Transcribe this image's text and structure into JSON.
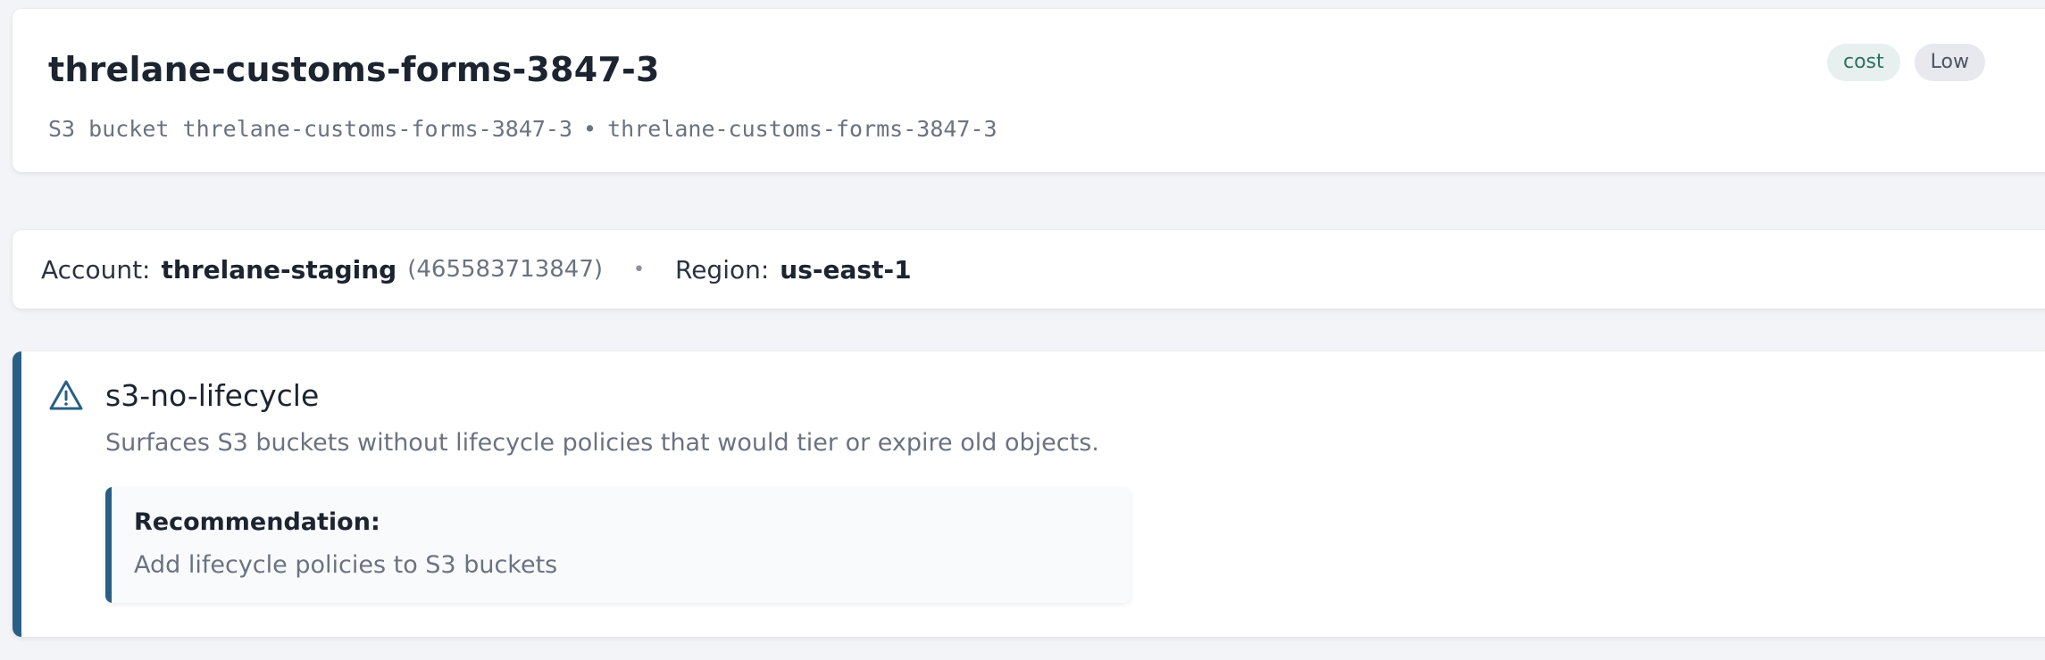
{
  "header": {
    "title": "threlane-customs-forms-3847-3",
    "subtitle_type": "S3 bucket",
    "subtitle_name": "threlane-customs-forms-3847-3",
    "subtitle_separator": "•",
    "subtitle_id": "threlane-customs-forms-3847-3",
    "badges": {
      "category": "cost",
      "severity": "Low"
    }
  },
  "info": {
    "account_label": "Account:",
    "account_name": "threlane-staging",
    "account_id": "(465583713847)",
    "separator": "•",
    "region_label": "Region:",
    "region_value": "us-east-1"
  },
  "finding": {
    "icon": "warning-triangle-icon",
    "title": "s3-no-lifecycle",
    "description": "Surfaces S3 buckets without lifecycle policies that would tier or expire old objects.",
    "recommendation_label": "Recommendation:",
    "recommendation_text": "Add lifecycle policies to S3 buckets"
  },
  "colors": {
    "accent": "#2a5f85",
    "cost_badge_bg": "#e7f0ee",
    "cost_badge_text": "#2e6f62",
    "low_badge_bg": "#e7e9ee",
    "page_bg": "#f3f4f7"
  }
}
